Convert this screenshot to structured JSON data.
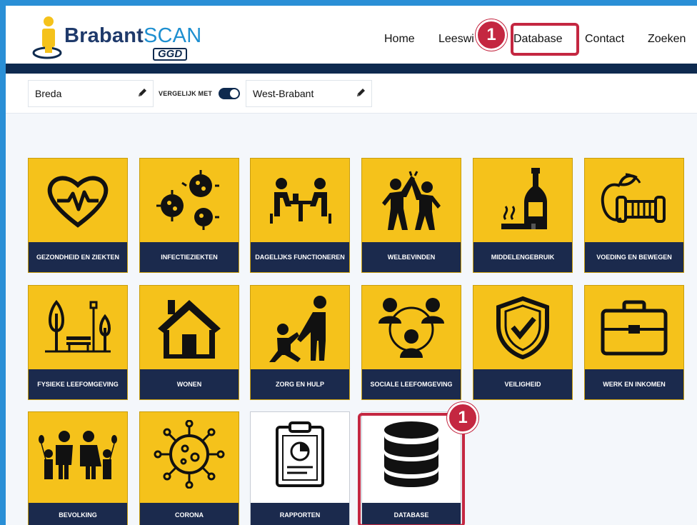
{
  "app": {
    "logo_brand": "Brabant",
    "logo_scan": "SCAN",
    "logo_sub": "GGD"
  },
  "nav": {
    "items": [
      {
        "label": "Home"
      },
      {
        "label": "Leeswi"
      },
      {
        "label": "Database"
      },
      {
        "label": "Contact"
      },
      {
        "label": "Zoeken"
      }
    ],
    "highlight_badge": "1"
  },
  "filter": {
    "location_primary": "Breda",
    "compare_label": "VERGELIJK MET",
    "compare_toggle_on": true,
    "location_compare": "West-Brabant"
  },
  "tiles": [
    {
      "label": "GEZONDHEID EN ZIEKTEN",
      "icon": "heart-pulse-icon"
    },
    {
      "label": "INFECTIEZIEKTEN",
      "icon": "virus-icon"
    },
    {
      "label": "DAGELIJKS FUNCTIONEREN",
      "icon": "people-table-icon"
    },
    {
      "label": "WELBEVINDEN",
      "icon": "high-five-icon"
    },
    {
      "label": "MIDDELENGEBRUIK",
      "icon": "bottle-cigarette-icon"
    },
    {
      "label": "VOEDING EN BEWEGEN",
      "icon": "apple-dumbbell-icon"
    },
    {
      "label": "FYSIEKE LEEFOMGEVING",
      "icon": "park-bench-icon"
    },
    {
      "label": "WONEN",
      "icon": "house-icon"
    },
    {
      "label": "ZORG EN HULP",
      "icon": "caregiver-icon"
    },
    {
      "label": "SOCIALE LEEFOMGEVING",
      "icon": "social-network-icon"
    },
    {
      "label": "VEILIGHEID",
      "icon": "shield-check-icon"
    },
    {
      "label": "WERK EN INKOMEN",
      "icon": "briefcase-icon"
    },
    {
      "label": "BEVOLKING",
      "icon": "family-icon"
    },
    {
      "label": "CORONA",
      "icon": "coronavirus-icon"
    },
    {
      "label": "RAPPORTEN",
      "icon": "clipboard-chart-icon"
    },
    {
      "label": "DATABASE",
      "icon": "database-icon"
    }
  ],
  "tile_highlight_badge": "1",
  "colors": {
    "tile_yellow": "#f5c21b",
    "tile_label_bg": "#1b2a4d",
    "navy": "#0e2a4f",
    "highlight_red": "#c42741",
    "frame_blue": "#2a8fd6"
  }
}
